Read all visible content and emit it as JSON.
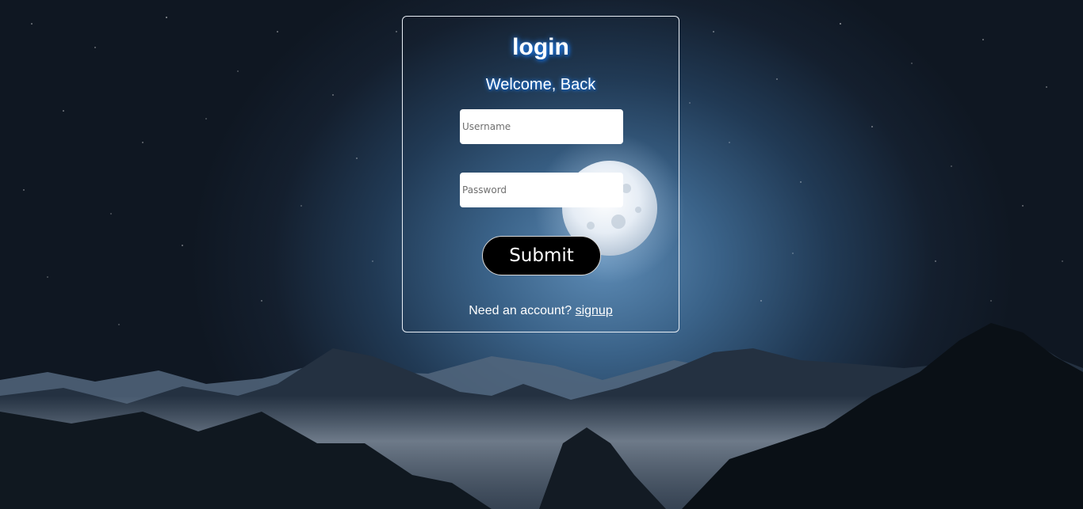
{
  "login": {
    "title": "login",
    "subtitle": "Welcome, Back",
    "username_placeholder": "Username",
    "password_placeholder": "Password",
    "submit_label": "Submit",
    "signup_prompt": "Need an account?",
    "signup_link": "signup"
  },
  "theme": {
    "card_border": "#e8eef5",
    "title_glow": "#2f8fff",
    "button_bg": "#000000",
    "text": "#ffffff"
  }
}
